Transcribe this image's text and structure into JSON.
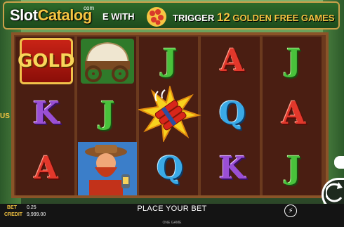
{
  "banner": {
    "logo_slot": "Slot",
    "logo_catalog": "Catalog",
    "logo_com": "com",
    "text_left": "E WITH",
    "trigger_word": "TRIGGER",
    "trigger_number": "12",
    "trigger_rest": "GOLDEN FREE GAMES"
  },
  "side": {
    "left_partial_text": "US"
  },
  "reels": [
    [
      "GOLD",
      "wagon",
      "J",
      "A",
      "J"
    ],
    [
      "K",
      "J",
      "dynamite",
      "Q",
      "A"
    ],
    [
      "A",
      "miner",
      "Q",
      "K",
      "J"
    ]
  ],
  "symbol_colors": {
    "J": "green",
    "A": "red",
    "K": "purple",
    "Q": "blue"
  },
  "bottom": {
    "bet_label": "BET",
    "bet_value": "0.25",
    "credit_label": "CREDIT",
    "credit_value": "9,999.00",
    "message": "PLACE YOUR BET",
    "footer": "ONE GAME"
  },
  "icons": [
    "dynamite-icon",
    "turbo-icon",
    "spin-icon",
    "play-icon"
  ]
}
